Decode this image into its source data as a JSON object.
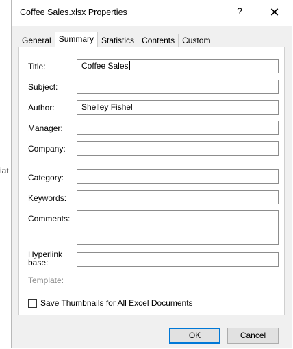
{
  "background": {
    "fragment_text": "iat"
  },
  "window": {
    "title": "Coffee Sales.xlsx Properties",
    "help_label": "?",
    "close_label": "✕"
  },
  "tabs": [
    {
      "label": "General"
    },
    {
      "label": "Summary",
      "active": true
    },
    {
      "label": "Statistics"
    },
    {
      "label": "Contents"
    },
    {
      "label": "Custom"
    }
  ],
  "fields": {
    "title": {
      "label": "Title:",
      "value": "Coffee Sales"
    },
    "subject": {
      "label": "Subject:",
      "value": ""
    },
    "author": {
      "label": "Author:",
      "value": "Shelley Fishel"
    },
    "manager": {
      "label": "Manager:",
      "value": ""
    },
    "company": {
      "label": "Company:",
      "value": ""
    },
    "category": {
      "label": "Category:",
      "value": ""
    },
    "keywords": {
      "label": "Keywords:",
      "value": ""
    },
    "comments": {
      "label": "Comments:",
      "value": ""
    },
    "hyperlink_base": {
      "label_line1": "Hyperlink",
      "label_line2": "base:",
      "value": ""
    },
    "template": {
      "label": "Template:"
    }
  },
  "checkbox": {
    "label": "Save Thumbnails for All Excel Documents",
    "checked": false
  },
  "buttons": {
    "ok": "OK",
    "cancel": "Cancel"
  },
  "colors": {
    "dialog_bg": "#f0f0f0",
    "panel_bg": "#ffffff",
    "default_button_border": "#0078d7"
  }
}
